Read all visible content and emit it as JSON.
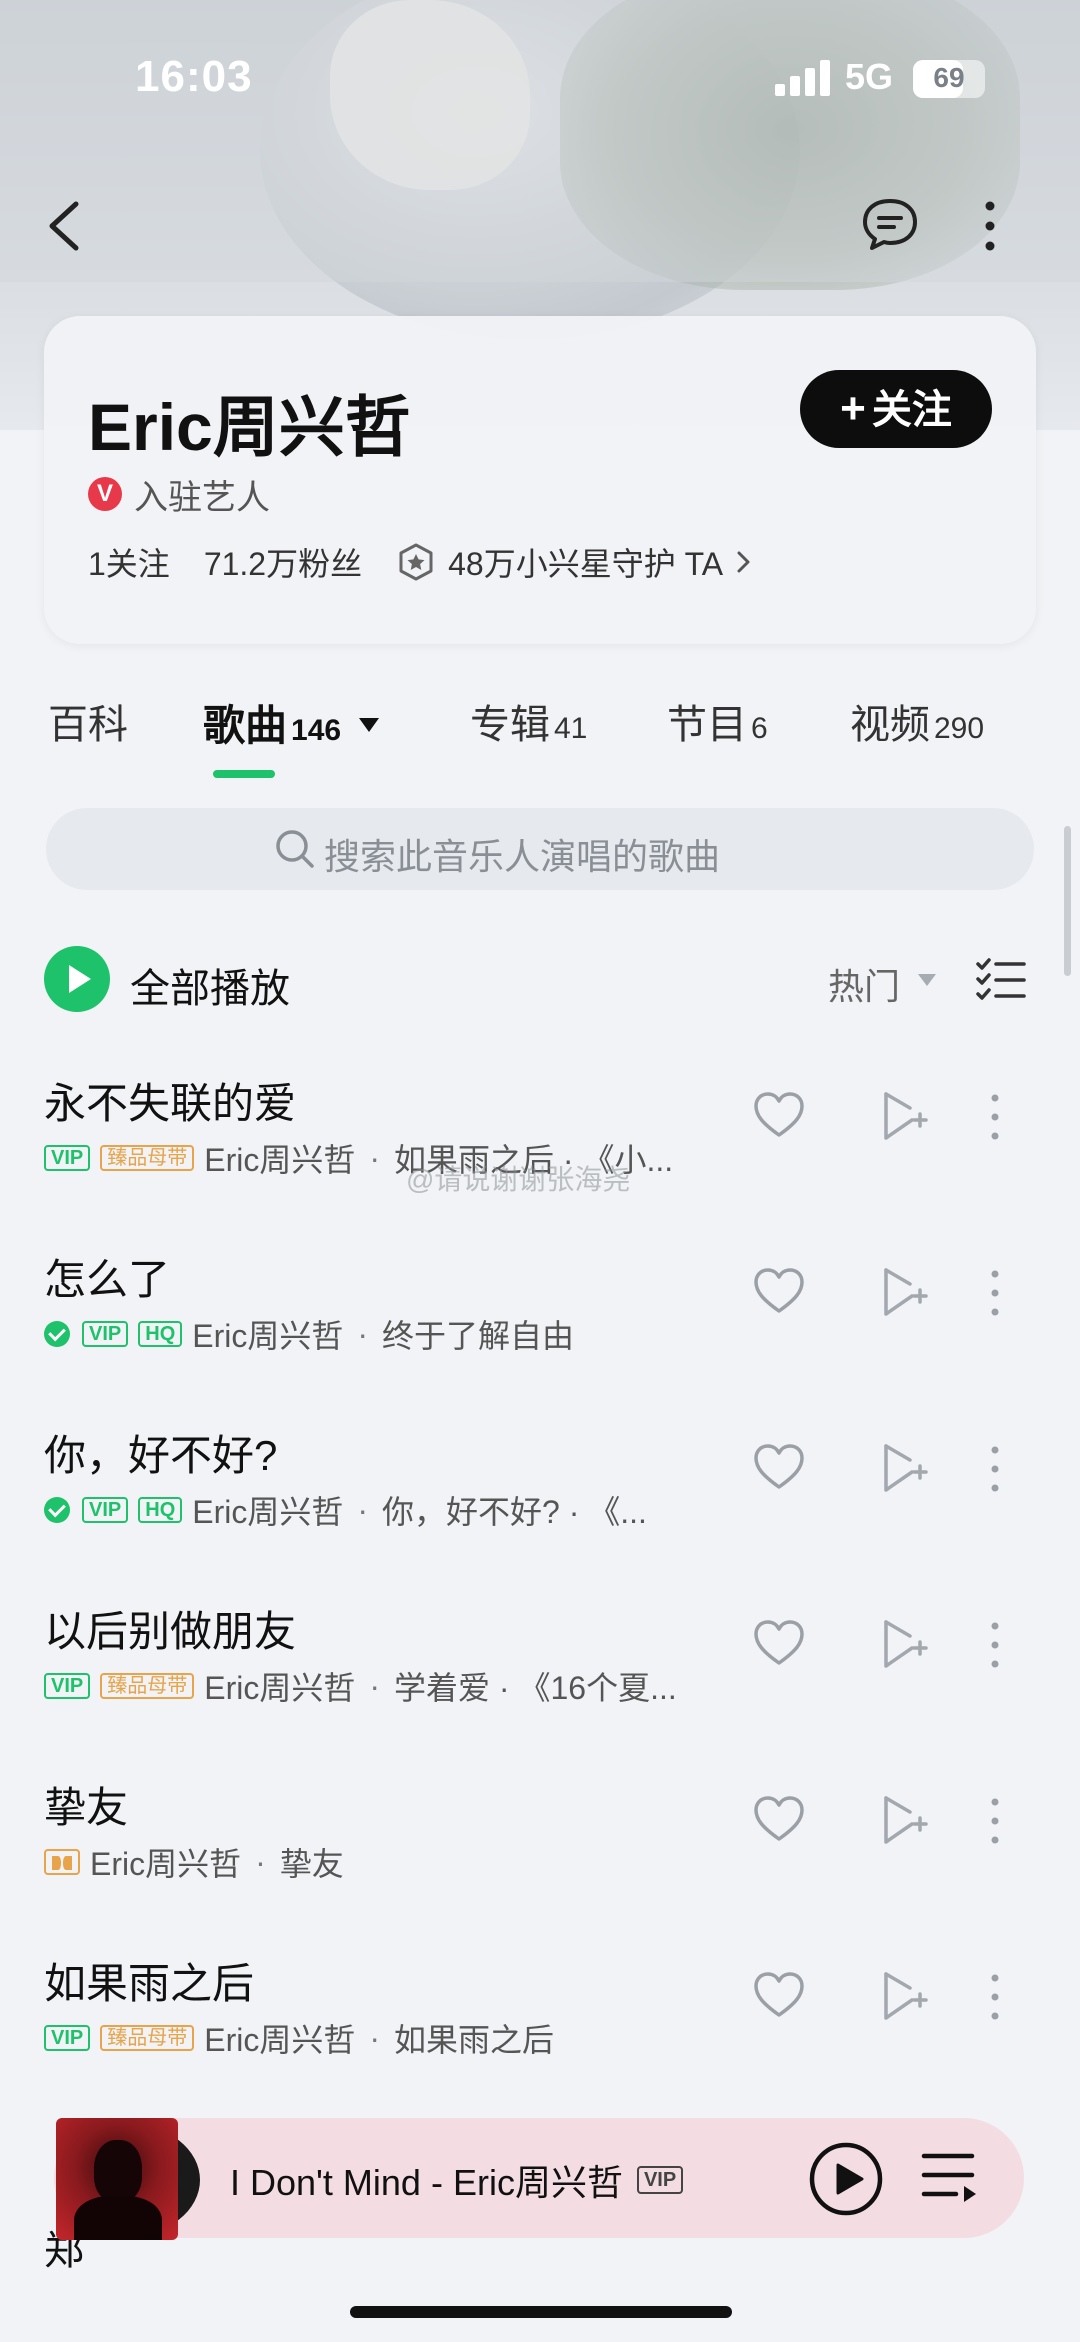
{
  "status_bar": {
    "time": "16:03",
    "network": "5G",
    "battery": "69",
    "battery_level": 0.69
  },
  "artist": {
    "name": "Eric周兴哲",
    "follow_label": "关注",
    "badge_letter": "V",
    "badge_text": "入驻艺人",
    "following": "1关注",
    "fans": "71.2万粉丝",
    "guardians": "48万小兴星守护 TA"
  },
  "tabs": [
    {
      "label": "百科",
      "count": ""
    },
    {
      "label": "歌曲",
      "count": "146"
    },
    {
      "label": "专辑",
      "count": "41"
    },
    {
      "label": "节目",
      "count": "6"
    },
    {
      "label": "视频",
      "count": "290"
    }
  ],
  "search": {
    "placeholder": "搜索此音乐人演唱的歌曲"
  },
  "list_header": {
    "play_all": "全部播放",
    "sort": "热门"
  },
  "songs": [
    {
      "title": "永不失联的爱",
      "artist": "Eric周兴哲",
      "info": "如果雨之后 · 《小...",
      "tags": [
        "VIP",
        "臻品母带"
      ],
      "verified": false
    },
    {
      "title": "怎么了",
      "artist": "Eric周兴哲",
      "info": "终于了解自由",
      "tags": [
        "VIP",
        "HQ"
      ],
      "verified": true
    },
    {
      "title": "你，好不好?",
      "artist": "Eric周兴哲",
      "info": "你，好不好? · 《...",
      "tags": [
        "VIP",
        "HQ"
      ],
      "verified": true
    },
    {
      "title": "以后别做朋友",
      "artist": "Eric周兴哲",
      "info": "学着爱 · 《16个夏...",
      "tags": [
        "VIP",
        "臻品母带"
      ],
      "verified": false
    },
    {
      "title": "挚友",
      "artist": "Eric周兴哲",
      "info": "挚友",
      "tags": [
        "dolby"
      ],
      "verified": false
    },
    {
      "title": "如果雨之后",
      "artist": "Eric周兴哲",
      "info": "如果雨之后",
      "tags": [
        "VIP",
        "臻品母带"
      ],
      "verified": false
    }
  ],
  "peek_char": "郑",
  "watermark": "@请说谢谢张海尧",
  "player": {
    "title": "I Don't Mind - Eric周兴哲",
    "tag": "VIP"
  },
  "colors": {
    "accent": "#1ec26a",
    "gold": "#e7a44a",
    "badge": "#e8394a",
    "player_bg": "#f3dde2"
  }
}
